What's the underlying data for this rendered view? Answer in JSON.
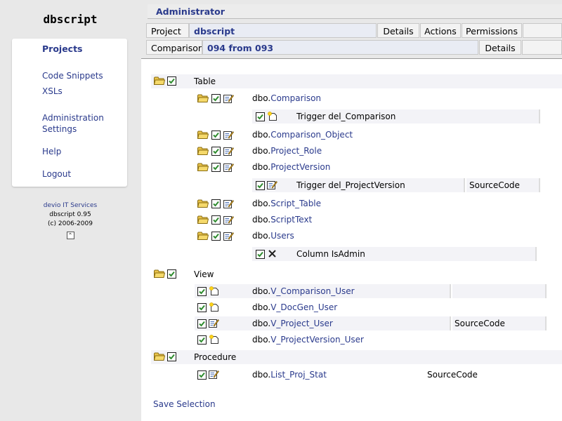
{
  "app": {
    "logo": "dbscript"
  },
  "sidebar": {
    "items": [
      {
        "label": "Projects",
        "active": true
      },
      {
        "label": "Code Snippets"
      },
      {
        "label": "XSLs"
      },
      {
        "label": "Administration"
      },
      {
        "label": "Settings"
      },
      {
        "label": "Help"
      },
      {
        "label": "Logout"
      }
    ],
    "credits": {
      "company": "devio IT Services",
      "version": "dbscript 0.95",
      "copyright": "(c) 2006-2009"
    }
  },
  "header": {
    "admin": "Administrator",
    "project_label": "Project",
    "project_value": "dbscript",
    "details": "Details",
    "actions": "Actions",
    "permissions": "Permissions",
    "comparison_label": "Comparison",
    "comparison_value": "094 from 093",
    "comparison_details": "Details"
  },
  "groups": {
    "table": "Table",
    "view": "View",
    "procedure": "Procedure"
  },
  "prefix": "dbo.",
  "objects": {
    "comparison": "Comparison",
    "comparison_object": "Comparison_Object",
    "project_role": "Project_Role",
    "projectversion": "ProjectVersion",
    "script_table": "Script_Table",
    "scripttext": "ScriptText",
    "users": "Users",
    "v_comparison_user": "V_Comparison_User",
    "v_docgen_user": "V_DocGen_User",
    "v_project_user": "V_Project_User",
    "v_projectversion_user": "V_ProjectVersion_User",
    "list_proj_stat": "List_Proj_Stat"
  },
  "subitems": {
    "trigger_del_comparison": "Trigger del_Comparison",
    "trigger_del_projectversion": "Trigger del_ProjectVersion",
    "column_isadmin": "Column IsAdmin"
  },
  "sourcecode": "SourceCode",
  "save_selection": "Save Selection",
  "colors": {
    "link": "#2a3a8c",
    "band": "#f3f3f7",
    "check": "#2e8b2e",
    "folder": "#e8c24a"
  }
}
